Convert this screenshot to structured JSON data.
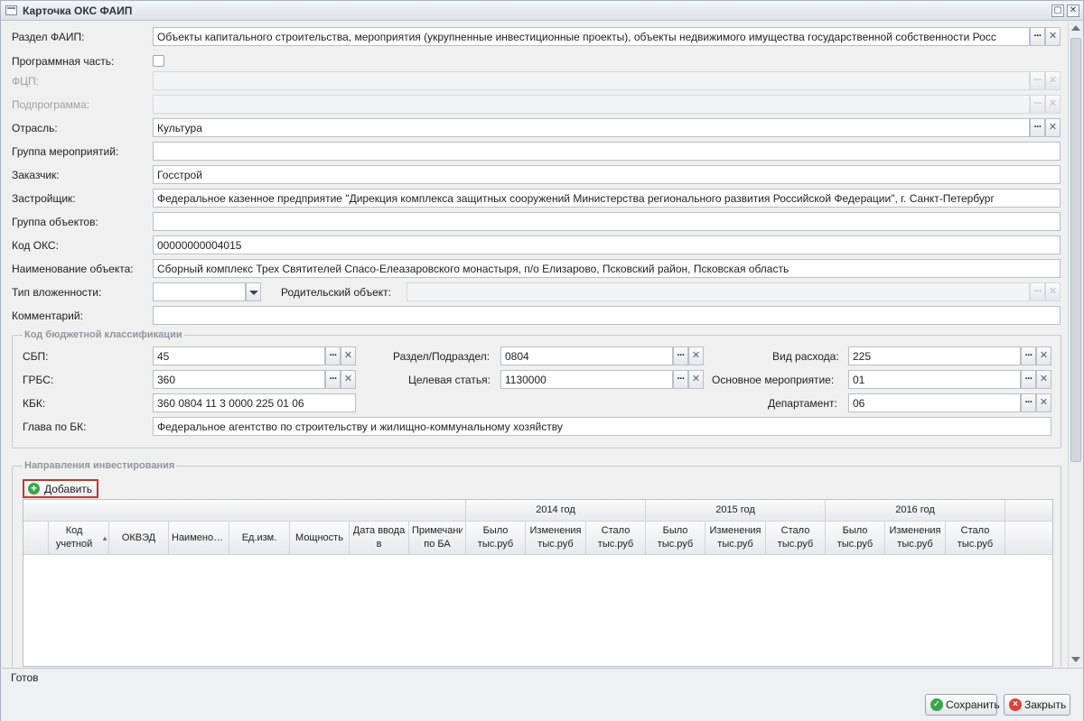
{
  "window": {
    "title": "Карточка ОКС ФАИП"
  },
  "form": {
    "razdel_faip": {
      "label": "Раздел ФАИП:",
      "value": "Объекты капитального строительства, мероприятия (укрупненные инвестиционные проекты), объекты недвижимого имущества государственной собственности Росс"
    },
    "programmnaya_chast": {
      "label": "Программная часть:",
      "checked": false
    },
    "fcp": {
      "label": "ФЦП:",
      "value": ""
    },
    "podprogramma": {
      "label": "Подпрограмма:",
      "value": ""
    },
    "otrasl": {
      "label": "Отрасль:",
      "value": "Культура"
    },
    "gruppa_meropriyatiy": {
      "label": "Группа мероприятий:",
      "value": ""
    },
    "zakazchik": {
      "label": "Заказчик:",
      "value": "Госстрой"
    },
    "zastroyshchik": {
      "label": "Застройщик:",
      "value": "Федеральное казенное предприятие \"Дирекция комплекса защитных сооружений Министерства регионального развития Российской Федерации\", г. Санкт-Петербург"
    },
    "gruppa_obektov": {
      "label": "Группа объектов:",
      "value": ""
    },
    "kod_oks": {
      "label": "Код ОКС:",
      "value": "00000000004015"
    },
    "naimenovanie_obekta": {
      "label": "Наименование объекта:",
      "value": "Сборный комплекс Трех Святителей Спасо-Елеазаровского монастыря, п/о Елизарово, Псковский район, Псковская область"
    },
    "tip_vlozhennosti": {
      "label": "Тип вложенности:",
      "value": ""
    },
    "roditelskiy_obekt": {
      "label": "Родительский объект:",
      "value": ""
    },
    "kommentariy": {
      "label": "Комментарий:",
      "value": ""
    }
  },
  "budget": {
    "legend": "Код бюджетной классификации",
    "sbp": {
      "label": "СБП:",
      "value": "45"
    },
    "grbs": {
      "label": "ГРБС:",
      "value": "360"
    },
    "kbk": {
      "label": "КБК:",
      "value": "360 0804 11 3 0000 225 01 06"
    },
    "glava_po_bk": {
      "label": "Глава по БК:",
      "value": "Федеральное агентство по строительству и жилищно-коммунальному хозяйству"
    },
    "razdel_podrazdel": {
      "label": "Раздел/Подраздел:",
      "value": "0804"
    },
    "celevaya_statya": {
      "label": "Целевая статья:",
      "value": "1130000"
    },
    "vid_raskhoda": {
      "label": "Вид расхода:",
      "value": "225"
    },
    "osnovnoe_meropriyatie": {
      "label": "Основное мероприятие:",
      "value": "01"
    },
    "departament": {
      "label": "Департамент:",
      "value": "06"
    }
  },
  "investments": {
    "legend": "Направления инвестирования",
    "add_label": "Добавить",
    "columns": {
      "kod": "Код учетной единицы",
      "okved": "ОКВЭД",
      "naimenovanie": "Наименование",
      "ed_izm": "Ед.изм.",
      "moshchnost": "Мощность",
      "data_vvoda": "Дата ввода в эксплуатацию",
      "primechanie": "Примечание по БА"
    },
    "years": [
      "2014 год",
      "2015 год",
      "2016 год"
    ],
    "year_cols": [
      "Было тыс.руб",
      "Изменения тыс.руб",
      "Стало тыс.руб"
    ]
  },
  "status": {
    "text": "Готов"
  },
  "footer": {
    "save_label": "Сохранить",
    "close_label": "Закрыть"
  }
}
